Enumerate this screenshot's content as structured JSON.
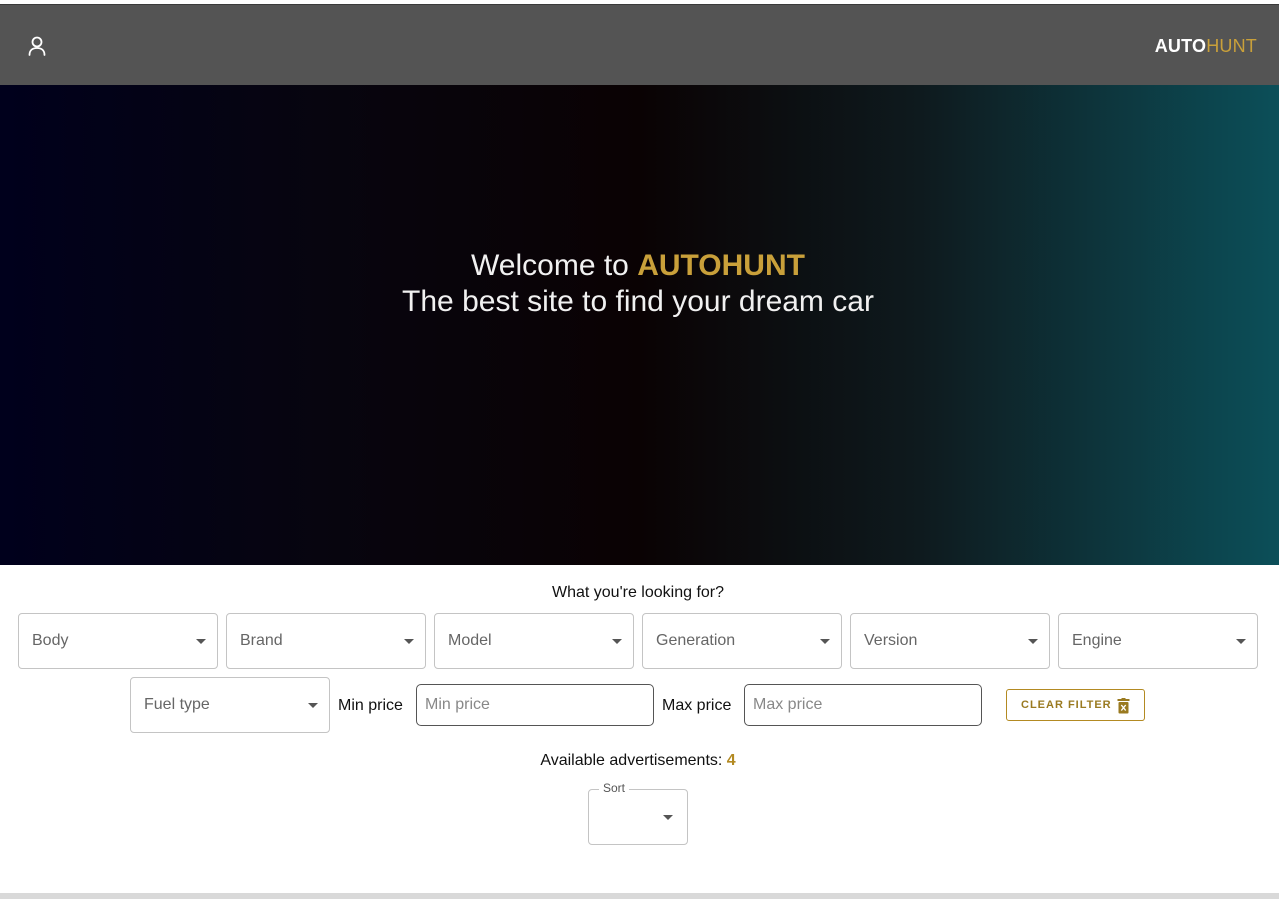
{
  "header": {
    "brand_part1": "AUTO",
    "brand_part2": "HUNT",
    "user_icon": "user-icon"
  },
  "hero": {
    "line1_prefix": "Welcome to ",
    "line1_brand": "AUTOHUNT",
    "line2": "The best site to find your dream car"
  },
  "filters": {
    "question": "What you're looking for?",
    "selects": [
      "Body",
      "Brand",
      "Model",
      "Generation",
      "Version",
      "Engine"
    ],
    "fuel_type": "Fuel type",
    "min_price_label": "Min price",
    "min_price_placeholder": "Min price",
    "max_price_label": "Max price",
    "max_price_placeholder": "Max price",
    "clear_label": "CLEAR FILTER",
    "clear_icon": "trash-icon"
  },
  "results": {
    "label": "Available advertisements: ",
    "count": "4"
  },
  "sort": {
    "label": "Sort"
  },
  "colors": {
    "accent": "#c9a03a",
    "navbar": "#545454"
  }
}
